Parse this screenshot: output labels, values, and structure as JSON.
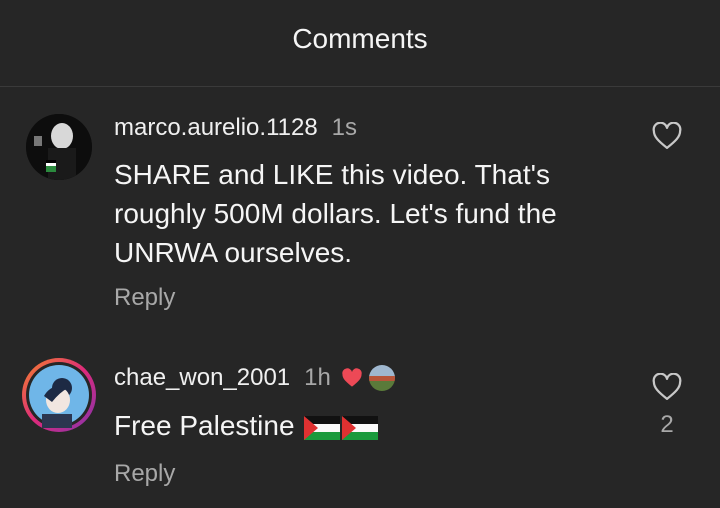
{
  "header": {
    "title": "Comments"
  },
  "comments": [
    {
      "username": "marco.aurelio.1128",
      "time": "1s",
      "text": "SHARE and LIKE this video. That's roughly 500M dollars. Let's fund the UNRWA ourselves.",
      "reply_label": "Reply",
      "like_icon": "heart-outline-icon"
    },
    {
      "username": "chae_won_2001",
      "time": "1h",
      "text": "Free Palestine",
      "reply_label": "Reply",
      "like_icon": "heart-outline-icon",
      "like_count": "2"
    }
  ],
  "colors": {
    "background": "#262626",
    "secondary_text": "#a8a8a8",
    "heart_red": "#ed4956",
    "story_ring": "#e1306c"
  }
}
